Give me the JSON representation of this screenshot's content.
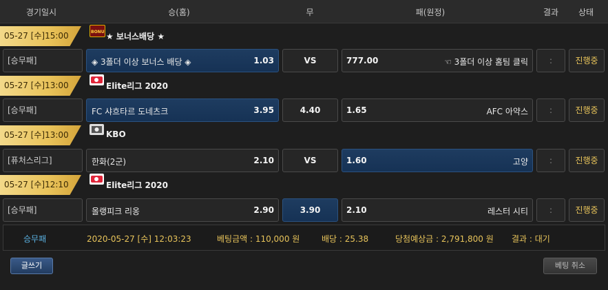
{
  "header": {
    "datetime": "경기일시",
    "home": "승(홈)",
    "draw": "무",
    "away": "패(원정)",
    "result": "결과",
    "status": "상태"
  },
  "sections": [
    {
      "date": "05-27 [수]15:00",
      "league": "★ 보너스배당 ★",
      "league_icon": "bonus-icon",
      "bet_type": "[승무패]",
      "home_team": "◈ 3폴더 이상 보너스 배당 ◈",
      "home_odds": "1.03",
      "draw": "VS",
      "away_odds": "777.00",
      "away_team": "☜ 3폴더 이상 홈팀 클릭",
      "result": ":",
      "status": "진행중",
      "selected": "home"
    },
    {
      "date": "05-27 [수]13:00",
      "league": "Elite리그 2020",
      "league_icon": "elite-league-icon",
      "bet_type": "[승무패]",
      "home_team": "FC 샤흐타르 도네츠크",
      "home_odds": "3.95",
      "draw": "4.40",
      "away_odds": "1.65",
      "away_team": "AFC 아약스",
      "result": ":",
      "status": "진행중",
      "selected": "home"
    },
    {
      "date": "05-27 [수]13:00",
      "league": "KBO",
      "league_icon": "kbo-icon",
      "bet_type": "[퓨처스리그]",
      "home_team": "한화(2군)",
      "home_odds": "2.10",
      "draw": "VS",
      "away_odds": "1.60",
      "away_team": "고양",
      "result": ":",
      "status": "진행중",
      "selected": "away"
    },
    {
      "date": "05-27 [수]12:10",
      "league": "Elite리그 2020",
      "league_icon": "elite-league-icon",
      "bet_type": "[승무패]",
      "home_team": "올랭피크 리옹",
      "home_odds": "2.90",
      "draw": "3.90",
      "away_odds": "2.10",
      "away_team": "레스터 시티",
      "result": ":",
      "status": "진행중",
      "selected": "draw"
    }
  ],
  "summary": {
    "type": "승무패",
    "datetime": "2020-05-27 [수] 12:03:23",
    "bet_amount": "베팅금액 : 110,000 원",
    "odds": "배당 : 25.38",
    "expected": "당첨예상금 : 2,791,800 원",
    "result": "결과 : 대기"
  },
  "buttons": {
    "write": "글쓰기",
    "cancel": "베팅 취소"
  },
  "colors": {
    "accent_gold": "#e9c35a",
    "selected_blue": "#1e3c60",
    "summary_cyan": "#5ab0e0"
  }
}
